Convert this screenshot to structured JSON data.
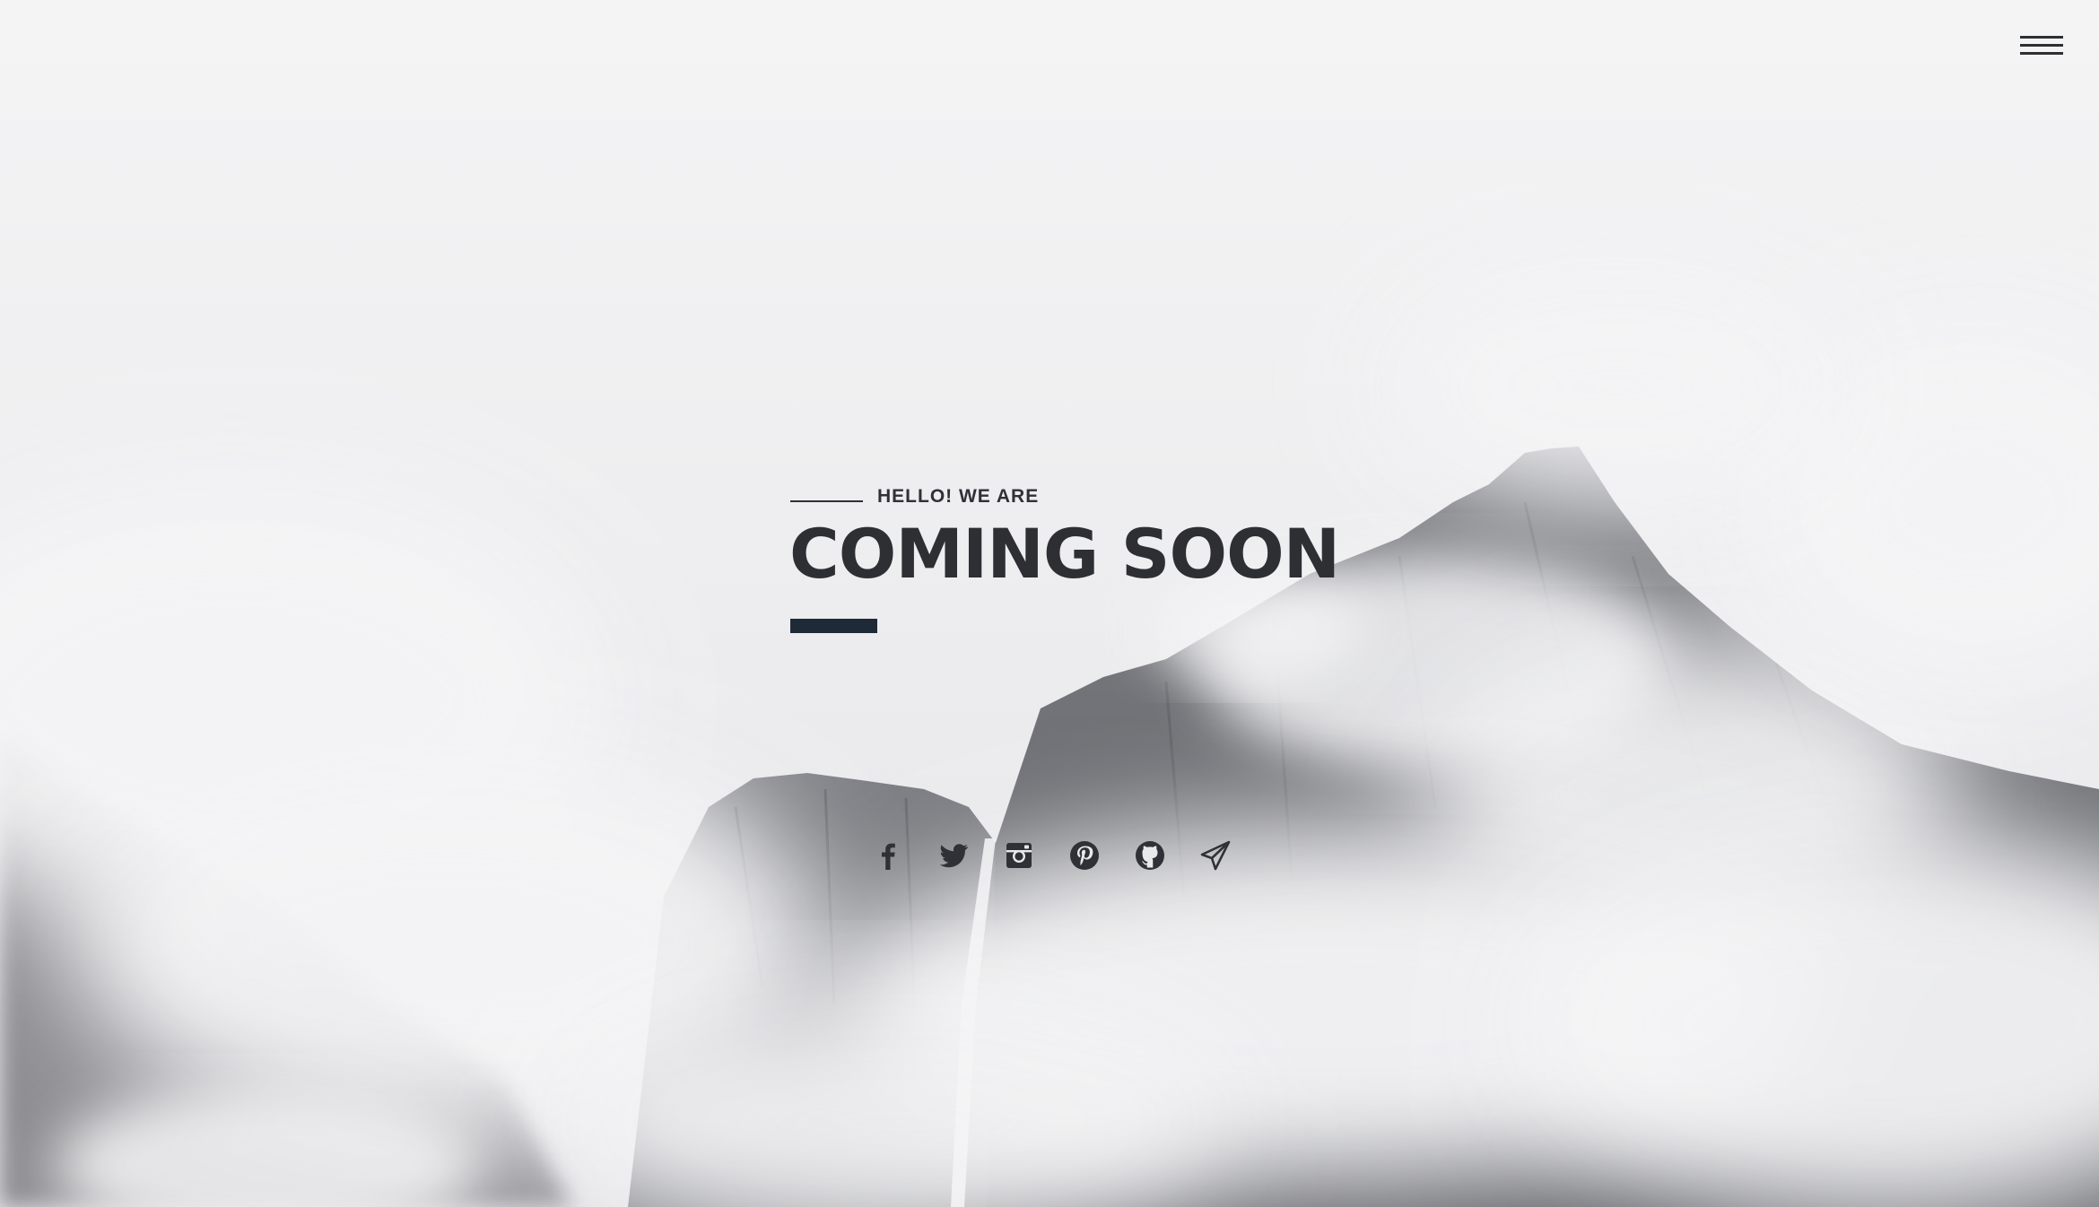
{
  "menu": {
    "icon": "hamburger-menu-icon"
  },
  "hero": {
    "intro": "HELLO! WE ARE",
    "headline": "COMING SOON",
    "accent_color": "#1f2a38",
    "text_color": "#2e2f33"
  },
  "social": [
    {
      "icon": "facebook-icon"
    },
    {
      "icon": "twitter-icon"
    },
    {
      "icon": "instagram-icon"
    },
    {
      "icon": "pinterest-icon"
    },
    {
      "icon": "github-icon"
    },
    {
      "icon": "send-icon"
    }
  ]
}
